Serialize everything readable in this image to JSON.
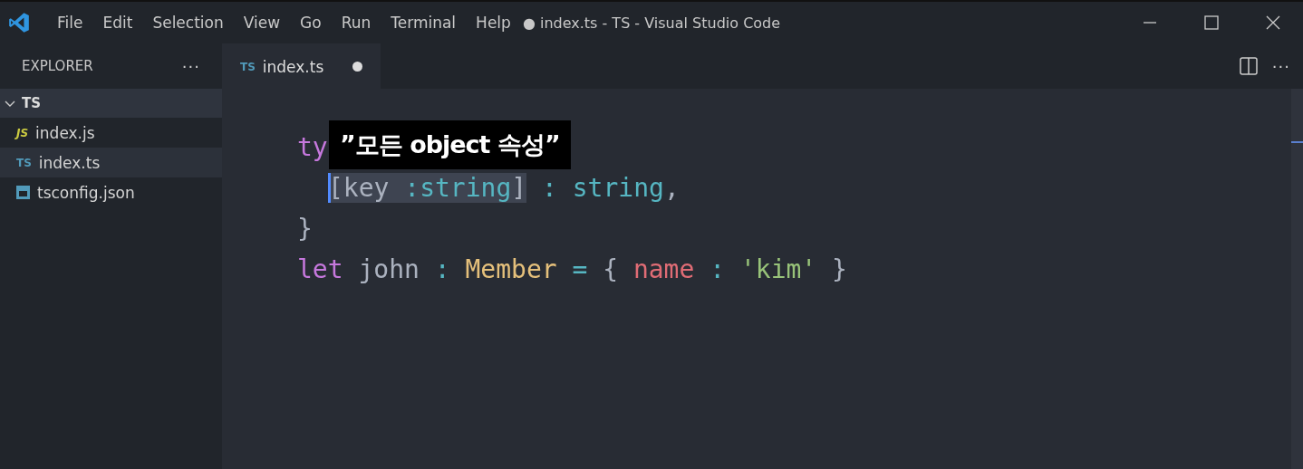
{
  "window": {
    "title": "● index.ts - TS - Visual Studio Code"
  },
  "menu": [
    "File",
    "Edit",
    "Selection",
    "View",
    "Go",
    "Run",
    "Terminal",
    "Help"
  ],
  "sidebar": {
    "title": "EXPLORER",
    "more": "···",
    "folder": {
      "label": "TS",
      "expanded": true,
      "files": [
        {
          "label": "index.js",
          "kind": "js",
          "icon": "JS",
          "selected": false
        },
        {
          "label": "index.ts",
          "kind": "ts",
          "icon": "TS",
          "selected": true
        },
        {
          "label": "tsconfig.json",
          "kind": "config",
          "selected": false
        }
      ]
    }
  },
  "tabs": [
    {
      "label": "index.ts",
      "icon": "TS",
      "selected": true,
      "unsaved": true
    }
  ],
  "editor_actions": {
    "more": "···"
  },
  "code": [
    {
      "indented": false,
      "tokens": [
        {
          "kind": "keyword",
          "text": "ty"
        }
      ]
    },
    {
      "indented": true,
      "tokens": [
        {
          "kind": "plain",
          "text": "[key ",
          "highlighted": true
        },
        {
          "kind": "type-name",
          "text": ":string",
          "highlighted": true
        },
        {
          "kind": "plain",
          "text": "]",
          "highlighted": true
        },
        {
          "kind": "type-name",
          "text": " : string"
        },
        {
          "kind": "plain",
          "text": ","
        }
      ]
    },
    {
      "indented": false,
      "tokens": [
        {
          "kind": "plain",
          "text": "}"
        }
      ]
    },
    {
      "indented": false,
      "tokens": [
        {
          "kind": "keyword",
          "text": "let"
        },
        {
          "kind": "plain",
          "text": " john "
        },
        {
          "kind": "type-name",
          "text": ": "
        },
        {
          "kind": "class",
          "text": "Member"
        },
        {
          "kind": "type-name",
          "text": " = "
        },
        {
          "kind": "plain",
          "text": "{ "
        },
        {
          "kind": "property",
          "text": "name"
        },
        {
          "kind": "type-name",
          "text": " : "
        },
        {
          "kind": "string",
          "text": "'kim'"
        },
        {
          "kind": "plain",
          "text": " }"
        }
      ]
    }
  ],
  "caption": {
    "text": "”모든 object 속성”"
  }
}
